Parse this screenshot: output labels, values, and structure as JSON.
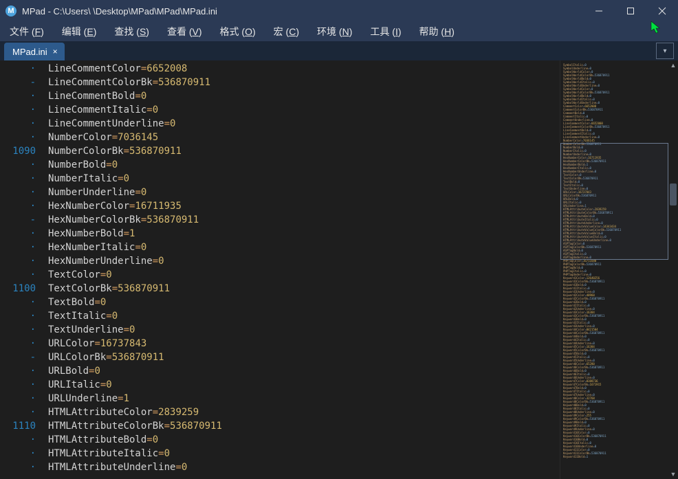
{
  "window": {
    "title": "MPad - C:\\Users\\    \\Desktop\\MPad\\MPad\\MPad.ini",
    "app_letter": "M"
  },
  "menu": [
    {
      "label": "文件",
      "accel": "F"
    },
    {
      "label": "编辑",
      "accel": "E"
    },
    {
      "label": "查找",
      "accel": "S"
    },
    {
      "label": "查看",
      "accel": "V"
    },
    {
      "label": "格式",
      "accel": "O"
    },
    {
      "label": "宏",
      "accel": "C"
    },
    {
      "label": "环境",
      "accel": "N"
    },
    {
      "label": "工具",
      "accel": "I"
    },
    {
      "label": "帮助",
      "accel": "H"
    }
  ],
  "tab": {
    "label": "MPad.ini"
  },
  "gutter_dot": "·",
  "gutter_dash": "-",
  "lines": [
    {
      "g": "·",
      "k": "LineCommentColor",
      "v": "6652008"
    },
    {
      "g": "-",
      "k": "LineCommentColorBk",
      "v": "536870911"
    },
    {
      "g": "·",
      "k": "LineCommentBold",
      "v": "0"
    },
    {
      "g": "·",
      "k": "LineCommentItalic",
      "v": "0"
    },
    {
      "g": "·",
      "k": "LineCommentUnderline",
      "v": "0"
    },
    {
      "g": "·",
      "k": "NumberColor",
      "v": "7036145"
    },
    {
      "g": "1090",
      "k": "NumberColorBk",
      "v": "536870911"
    },
    {
      "g": "·",
      "k": "NumberBold",
      "v": "0"
    },
    {
      "g": "·",
      "k": "NumberItalic",
      "v": "0"
    },
    {
      "g": "·",
      "k": "NumberUnderline",
      "v": "0"
    },
    {
      "g": "·",
      "k": "HexNumberColor",
      "v": "16711935"
    },
    {
      "g": "-",
      "k": "HexNumberColorBk",
      "v": "536870911"
    },
    {
      "g": "·",
      "k": "HexNumberBold",
      "v": "1"
    },
    {
      "g": "·",
      "k": "HexNumberItalic",
      "v": "0"
    },
    {
      "g": "·",
      "k": "HexNumberUnderline",
      "v": "0"
    },
    {
      "g": "·",
      "k": "TextColor",
      "v": "0"
    },
    {
      "g": "1100",
      "k": "TextColorBk",
      "v": "536870911"
    },
    {
      "g": "·",
      "k": "TextBold",
      "v": "0"
    },
    {
      "g": "·",
      "k": "TextItalic",
      "v": "0"
    },
    {
      "g": "·",
      "k": "TextUnderline",
      "v": "0"
    },
    {
      "g": "·",
      "k": "URLColor",
      "v": "16737843"
    },
    {
      "g": "-",
      "k": "URLColorBk",
      "v": "536870911"
    },
    {
      "g": "·",
      "k": "URLBold",
      "v": "0"
    },
    {
      "g": "·",
      "k": "URLItalic",
      "v": "0"
    },
    {
      "g": "·",
      "k": "URLUnderline",
      "v": "1"
    },
    {
      "g": "·",
      "k": "HTMLAttributeColor",
      "v": "2839259"
    },
    {
      "g": "1110",
      "k": "HTMLAttributeColorBk",
      "v": "536870911"
    },
    {
      "g": "·",
      "k": "HTMLAttributeBold",
      "v": "0"
    },
    {
      "g": "·",
      "k": "HTMLAttributeItalic",
      "v": "0"
    },
    {
      "g": "·",
      "k": "HTMLAttributeUnderline",
      "v": "0"
    }
  ],
  "minimap": [
    "SymbolItalic=0",
    "SymbolUnderline=0",
    "SymbolWorldColor=0",
    "SymbolWorldColorBk=536870911",
    "SymbolWorldBold=0",
    "SymbolWorldItalic=0",
    "SymbolWorldUnderline=0",
    "SymbolWorldColor=0",
    "SymbolWorldColorBk=536870911",
    "SymbolWorldBold=0",
    "SymbolWorldItalic=0",
    "SymbolWorldUnderline=0",
    "CommentColor=6652008",
    "CommentColorBk=536870911",
    "CommentBold=0",
    "CommentItalic=0",
    "CommentUnderline=0",
    "LineCommentColor=6652008",
    "LineCommentColorBk=536870911",
    "LineCommentBold=0",
    "LineCommentItalic=0",
    "LineCommentUnderline=0",
    "NumberColor=7036145",
    "NumberColorBk=536870911",
    "NumberBold=0",
    "NumberItalic=0",
    "NumberUnderline=0",
    "HexNumberColor=16711935",
    "HexNumberColorBk=536870911",
    "HexNumberBold=1",
    "HexNumberItalic=0",
    "HexNumberUnderline=0",
    "TextColor=0",
    "TextColorBk=536870911",
    "TextBold=0",
    "TextItalic=0",
    "TextUnderline=0",
    "URLColor=16737843",
    "URLColorBk=536870911",
    "URLBold=0",
    "URLItalic=0",
    "URLUnderline=1",
    "HTMLAttributeColor=2839259",
    "HTMLAttributeColorBk=536870911",
    "HTMLAttributeBold=0",
    "HTMLAttributeItalic=0",
    "HTMLAttributeUnderline=0",
    "HTMLAttributeValueColor=14343434",
    "HTMLAttributeValueColorBk=536870911",
    "HTMLAttributeValueBold=0",
    "HTMLAttributeValueItalic=0",
    "HTMLAttributeValueUnderline=0",
    "ASPTagColor=0",
    "ASPTagColorBk=536870911",
    "ASPTagBold=0",
    "ASPTagItalic=0",
    "ASPTagUnderline=0",
    "PHPTagColor=16711680",
    "PHPTagColorBk=536870911",
    "PHPTagBold=0",
    "PHPTagItalic=0",
    "PHPTagUnderline=0",
    "Keyword1Color=12640256",
    "Keyword1ColorBk=536870911",
    "Keyword1Bold=0",
    "Keyword1Italic=0",
    "Keyword1Underline=0",
    "Keyword2Color=40960",
    "Keyword2ColorBk=536870911",
    "Keyword2Bold=0",
    "Keyword2Italic=0",
    "Keyword2Underline=0",
    "Keyword3Color=16384",
    "Keyword3ColorBk=536870911",
    "Keyword3Bold=0",
    "Keyword3Italic=0",
    "Keyword3Underline=0",
    "Keyword4Color=8421504",
    "Keyword4ColorBk=536870911",
    "Keyword4Bold=0",
    "Keyword4Italic=0",
    "Keyword4Underline=0",
    "Keyword5Color=16384",
    "Keyword5ColorBk=536870911",
    "Keyword5Bold=0",
    "Keyword5Italic=0",
    "Keyword5Underline=0",
    "Keyword6Color=65280",
    "Keyword6ColorBk=536870911",
    "Keyword6Bold=0",
    "Keyword6Italic=0",
    "Keyword6Underline=0",
    "Keyword7Color=8388736",
    "Keyword7ColorBk=1671915",
    "Keyword7Bold=0",
    "Keyword7Italic=0",
    "Keyword7Underline=0",
    "Keyword8Color=32768",
    "Keyword8ColorBk=536870911",
    "Keyword8Bold=0",
    "Keyword8Italic=0",
    "Keyword8Underline=0",
    "Keyword9Color=255",
    "Keyword9ColorBk=536870911",
    "Keyword9Bold=0",
    "Keyword9Italic=0",
    "Keyword9Underline=0",
    "Keyword10Color=0",
    "Keyword10ColorBk=536870911",
    "Keyword10Bold=0",
    "Keyword10Italic=0",
    "Keyword10Underline=0",
    "Keyword11Color=0",
    "Keyword11ColorBk=536870911",
    "Keyword11Bold=1"
  ]
}
